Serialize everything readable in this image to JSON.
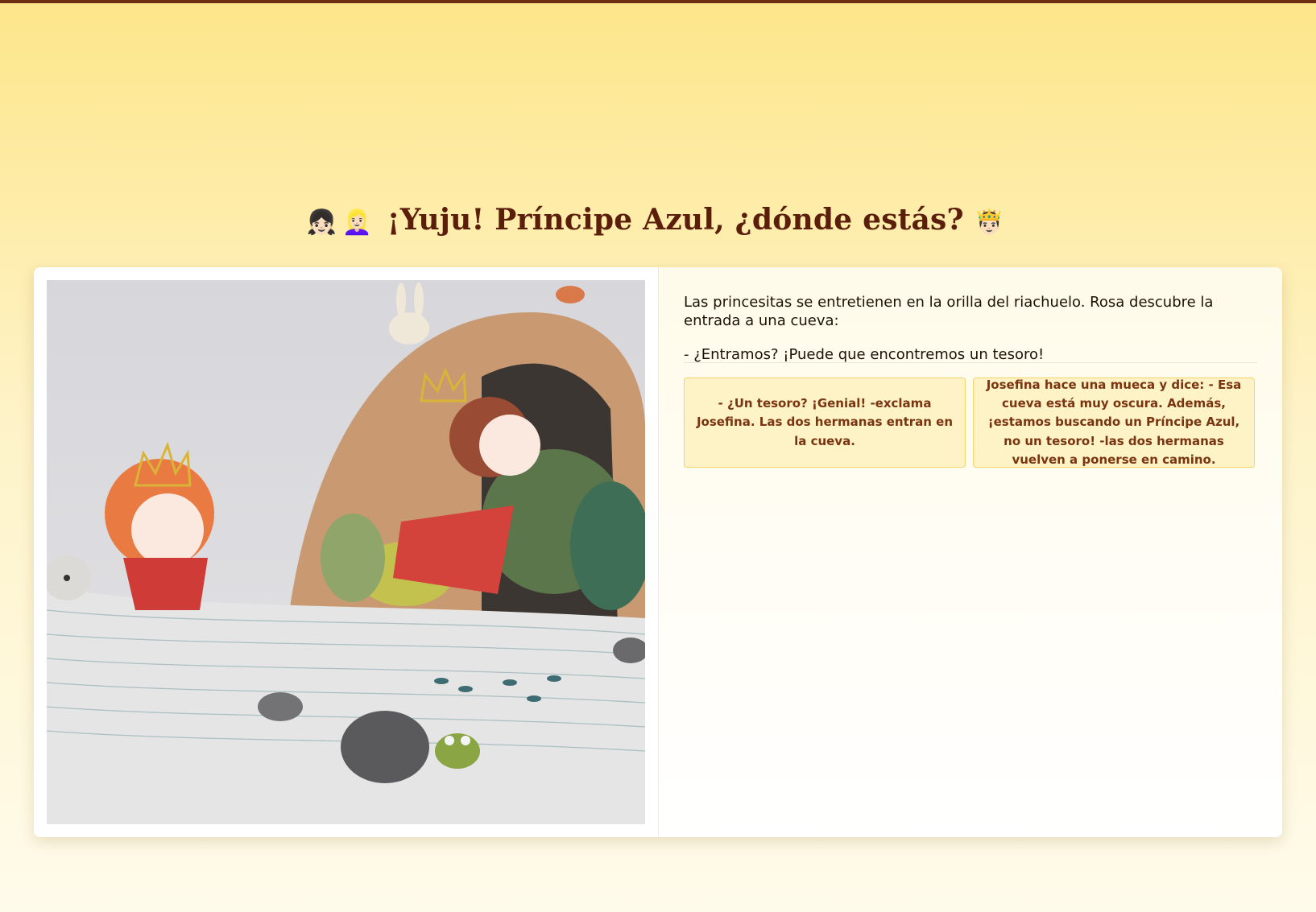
{
  "page": {
    "title_emojis": [
      "👧🏻",
      "👱🏻‍♀️"
    ],
    "title": "¡Yuju! Príncipe Azul, ¿dónde estás?",
    "title_trailing_emoji": "🤴🏻"
  },
  "story": {
    "paragraphs": [
      "Las princesitas se entretienen en la orilla del riachuelo. Rosa descubre la entrada a una cueva:",
      "- ¿Entramos? ¡Puede que encontremos un tesoro!"
    ],
    "choices": [
      "- ¿Un tesoro? ¡Genial! -exclama Josefina. Las dos hermanas entran en la cueva.",
      "Josefina hace una mueca y dice: - Esa cueva está muy oscura. Además, ¡estamos buscando un Príncipe Azul, no un tesoro! -las dos hermanas vuelven a ponerse en camino."
    ]
  },
  "colors": {
    "accent": "#5a1e0a",
    "choice_bg": "#fef3c7",
    "choice_border": "#f5d36a",
    "choice_text": "#7a3510",
    "background_top": "#fde68a",
    "background_bottom": "#fffbeb"
  }
}
